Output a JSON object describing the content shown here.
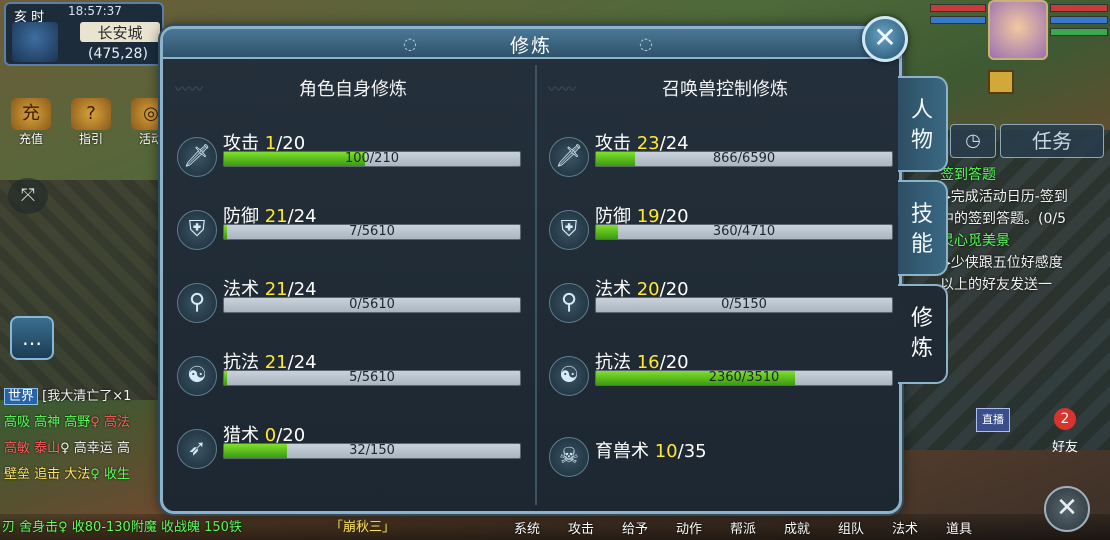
{
  "hud": {
    "period": "亥 时",
    "clock": "18:57:37",
    "city": "长安城",
    "coords": "(475,28)",
    "left_icons": [
      {
        "label": "充值",
        "glyph": "充"
      },
      {
        "label": "指引",
        "glyph": "?"
      },
      {
        "label": "活动",
        "glyph": "◎"
      }
    ]
  },
  "chat": {
    "channel": "世界",
    "first_line": "[我大清亡了×1",
    "lines": [
      [
        {
          "t": "高吸 ",
          "c": "green"
        },
        {
          "t": "高神 ",
          "c": "green"
        },
        {
          "t": "高野",
          "c": "green"
        },
        {
          "t": "♀ 高法",
          "c": "red"
        }
      ],
      [
        {
          "t": "高敏 ",
          "c": "red"
        },
        {
          "t": "泰山",
          "c": "red"
        },
        {
          "t": "♀ 高幸运 高",
          "c": "white"
        }
      ],
      [
        {
          "t": "壁垒 ",
          "c": "yellow"
        },
        {
          "t": "追击 ",
          "c": "yellow"
        },
        {
          "t": "大法",
          "c": "yellow"
        },
        {
          "t": "♀ 收生",
          "c": "green"
        }
      ]
    ],
    "bottom": "刃 舍身击♀ 收80-130附魔 收战魄 150铁"
  },
  "bottom_menu": {
    "secret": "「崩秋三」",
    "items": [
      "系统",
      "攻击",
      "给予",
      "动作",
      "帮派",
      "成就",
      "组队",
      "法术",
      "道具"
    ]
  },
  "right_hud": {
    "task_tab": "任务",
    "quest_lines": [
      {
        "t": "签到答题",
        "c": "green"
      },
      {
        "t": "▶完成活动日历-签到",
        "c": "white"
      },
      {
        "t": "中的签到答题。(0/5",
        "c": "white"
      },
      {
        "t": "灵心觅美景",
        "c": "green"
      },
      {
        "t": "▶少侠跟五位好感度",
        "c": "white"
      },
      {
        "t": "以上的好友发送一",
        "c": "white"
      }
    ],
    "live_badge": "直播",
    "friends_label": "好友",
    "friends_count": "2"
  },
  "panel": {
    "title": "修炼",
    "left_title": "角色自身修炼",
    "right_title": "召唤兽控制修炼",
    "left_rows": [
      {
        "name": "攻击",
        "level": "1",
        "max": "/20",
        "bar_text": "100/210",
        "progress": 0.476,
        "icon": "sword"
      },
      {
        "name": "防御",
        "level": "21",
        "max": "/24",
        "bar_text": "7/5610",
        "progress": 0.0012,
        "icon": "shield"
      },
      {
        "name": "法术",
        "level": "21",
        "max": "/24",
        "bar_text": "0/5610",
        "progress": 0.0,
        "icon": "staff"
      },
      {
        "name": "抗法",
        "level": "21",
        "max": "/24",
        "bar_text": "5/5610",
        "progress": 0.0009,
        "icon": "yin-yang"
      },
      {
        "name": "猎术",
        "level": "0",
        "max": "/20",
        "bar_text": "32/150",
        "progress": 0.213,
        "icon": "bow"
      }
    ],
    "right_rows": [
      {
        "name": "攻击",
        "level": "23",
        "max": "/24",
        "bar_text": "866/6590",
        "progress": 0.131,
        "icon": "sword"
      },
      {
        "name": "防御",
        "level": "19",
        "max": "/20",
        "bar_text": "360/4710",
        "progress": 0.076,
        "icon": "shield"
      },
      {
        "name": "法术",
        "level": "20",
        "max": "/20",
        "bar_text": "0/5150",
        "progress": 0.0,
        "icon": "staff"
      },
      {
        "name": "抗法",
        "level": "16",
        "max": "/20",
        "bar_text": "2360/3510",
        "progress": 0.672,
        "icon": "yin-yang"
      }
    ],
    "pet_breeding": {
      "name": "育兽术",
      "level": "10",
      "max": "/35",
      "icon": "skull"
    },
    "tabs": [
      {
        "label": "人物",
        "active": false
      },
      {
        "label": "技能",
        "active": false
      },
      {
        "label": "修炼",
        "active": true
      }
    ]
  }
}
